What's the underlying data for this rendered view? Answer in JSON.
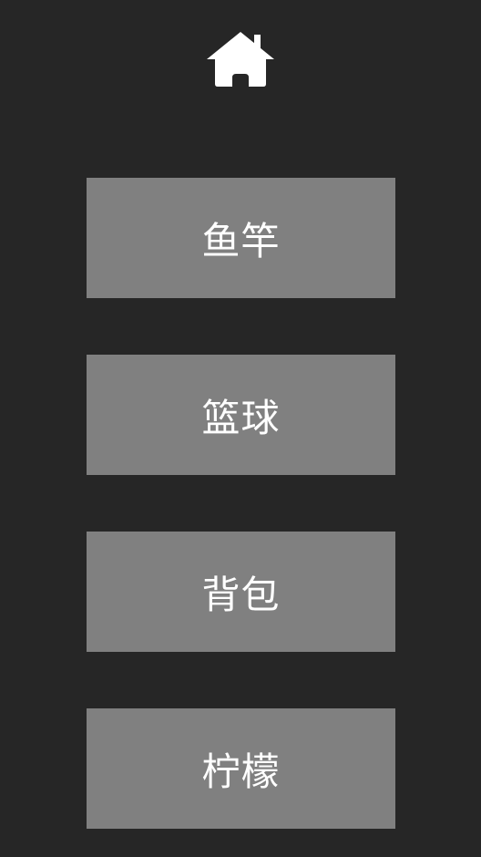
{
  "header": {
    "home_icon": "home-icon"
  },
  "menu": {
    "items": [
      {
        "label": "鱼竿"
      },
      {
        "label": "篮球"
      },
      {
        "label": "背包"
      },
      {
        "label": "柠檬"
      }
    ]
  },
  "colors": {
    "background": "#262626",
    "button": "#808080",
    "text": "#ffffff"
  }
}
